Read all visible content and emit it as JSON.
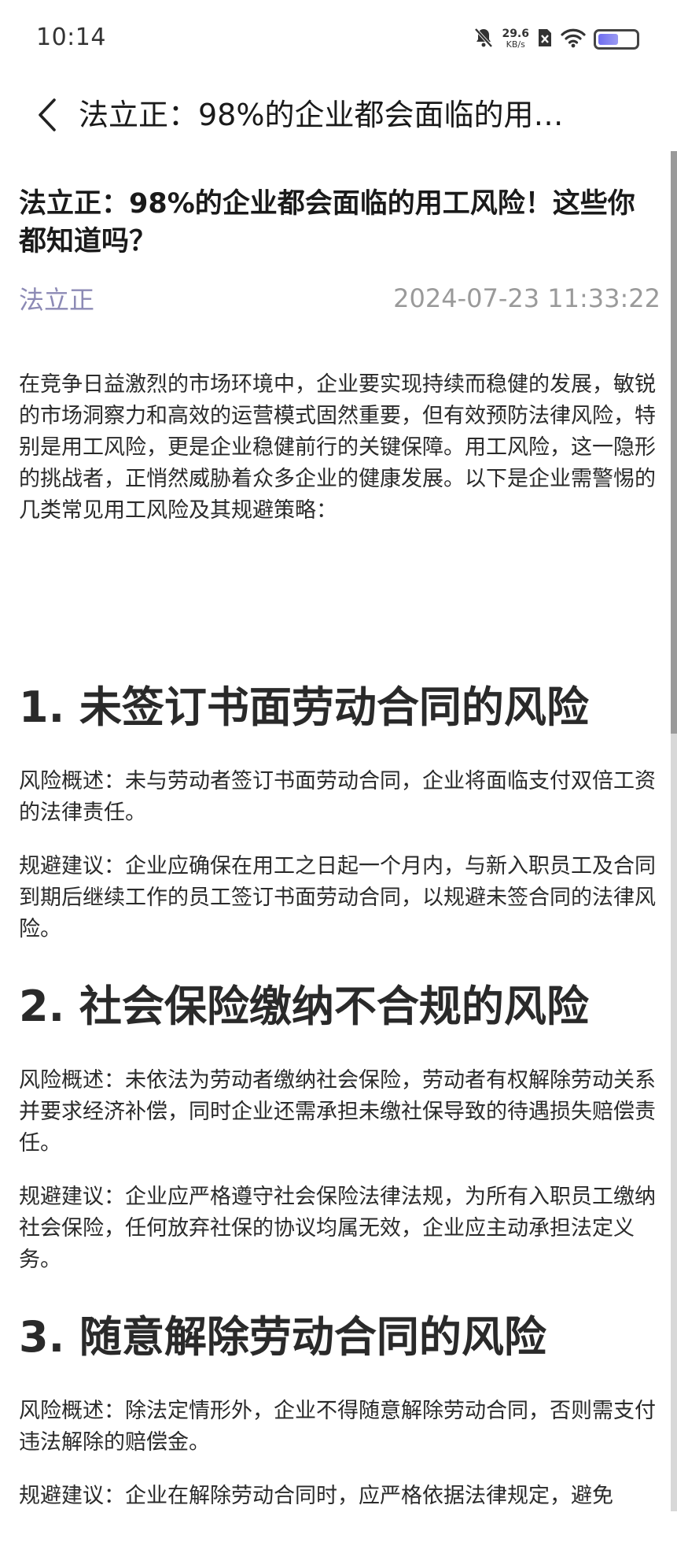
{
  "status_bar": {
    "time": "10:14",
    "net_speed_value": "29.6",
    "net_speed_unit": "KB/s",
    "battery_level": 0.55
  },
  "nav": {
    "title": "法立正：98%的企业都会面临的用…"
  },
  "article": {
    "title": "法立正：98%的企业都会面临的用工风险！这些你都知道吗？",
    "author": "法立正",
    "date": "2024-07-23 11:33:22",
    "intro": "在竞争日益激烈的市场环境中，企业要实现持续而稳健的发展，敏锐的市场洞察力和高效的运营模式固然重要，但有效预防法律风险，特别是用工风险，更是企业稳健前行的关键保障。用工风险，这一隐形的挑战者，正悄然威胁着众多企业的健康发展。以下是企业需警惕的几类常见用工风险及其规避策略：",
    "sections": [
      {
        "heading": "1. 未签订书面劳动合同的风险",
        "overview": "风险概述：未与劳动者签订书面劳动合同，企业将面临支付双倍工资的法律责任。",
        "advice": "规避建议：企业应确保在用工之日起一个月内，与新入职员工及合同到期后继续工作的员工签订书面劳动合同，以规避未签合同的法律风险。"
      },
      {
        "heading": "2. 社会保险缴纳不合规的风险",
        "overview": "风险概述：未依法为劳动者缴纳社会保险，劳动者有权解除劳动关系并要求经济补偿，同时企业还需承担未缴社保导致的待遇损失赔偿责任。",
        "advice": "规避建议：企业应严格遵守社会保险法律法规，为所有入职员工缴纳社会保险，任何放弃社保的协议均属无效，企业应主动承担法定义务。"
      },
      {
        "heading": "3. 随意解除劳动合同的风险",
        "overview": "风险概述：除法定情形外，企业不得随意解除劳动合同，否则需支付违法解除的赔偿金。",
        "advice": "规避建议：企业在解除劳动合同时，应严格依据法律规定，避免"
      }
    ]
  },
  "colors": {
    "author": "#8c8ab5",
    "date": "#9a9a9a",
    "battery_fill": "#7a78f0"
  }
}
